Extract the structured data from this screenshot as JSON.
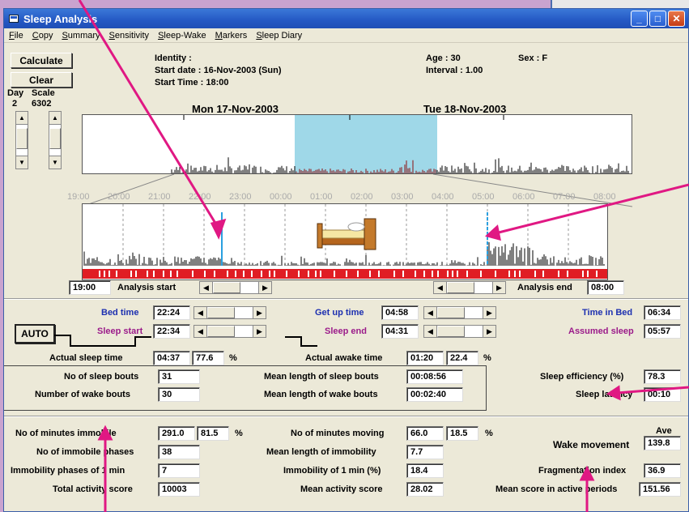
{
  "window": {
    "title": "Sleep Analysis"
  },
  "menu": [
    "File",
    "Copy",
    "Summary",
    "Sensitivity",
    "Sleep-Wake",
    "Markers",
    "Sleep Diary"
  ],
  "buttons": {
    "calculate": "Calculate",
    "clear": "Clear",
    "auto": "AUTO"
  },
  "controls": {
    "day_label": "Day",
    "day_value": "2",
    "scale_label": "Scale",
    "scale_value": "6302"
  },
  "header": {
    "identity": "Identity :",
    "start_date": "Start date : 16-Nov-2003 (Sun)",
    "start_time": "Start Time : 18:00",
    "age": "Age : 30",
    "sex": "Sex : F",
    "interval": "Interval  : 1.00"
  },
  "overview": {
    "date1": "Mon 17-Nov-2003",
    "date2": "Tue 18-Nov-2003"
  },
  "time_ticks": [
    "19:00",
    "20:00",
    "21:00",
    "22:00",
    "23:00",
    "00:00",
    "01:00",
    "02:00",
    "03:00",
    "04:00",
    "05:00",
    "06:00",
    "07:00",
    "08:00"
  ],
  "analysis": {
    "start_value": "19:00",
    "start_label": "Analysis start",
    "end_label": "Analysis end",
    "end_value": "08:00"
  },
  "times": {
    "bed_time_label": "Bed time",
    "bed_time": "22:24",
    "sleep_start_label": "Sleep start",
    "sleep_start": "22:34",
    "get_up_label": "Get up time",
    "get_up": "04:58",
    "sleep_end_label": "Sleep end",
    "sleep_end": "04:31",
    "time_in_bed_label": "Time in Bed",
    "time_in_bed": "06:34",
    "assumed_sleep_label": "Assumed sleep",
    "assumed_sleep": "05:57"
  },
  "actual": {
    "sleep_label": "Actual sleep time",
    "sleep_time": "04:37",
    "sleep_pct": "77.6",
    "pct": "%",
    "awake_label": "Actual awake time",
    "awake_time": "01:20",
    "awake_pct": "22.4"
  },
  "bouts": {
    "sleep_bouts_label": "No of sleep bouts",
    "sleep_bouts": "31",
    "wake_bouts_label": "Number of wake bouts",
    "wake_bouts": "30",
    "mean_sleep_label": "Mean length of sleep bouts",
    "mean_sleep": "00:08:56",
    "mean_wake_label": "Mean length of wake bouts",
    "mean_wake": "00:02:40",
    "efficiency_label": "Sleep efficiency (%)",
    "efficiency": "78.3",
    "latency_label": "Sleep latency",
    "latency": "00:10"
  },
  "activity": {
    "immobile_min_label": "No of minutes immobile",
    "immobile_min": "291.0",
    "immobile_pct": "81.5",
    "immobile_phases_label": "No of immobile phases",
    "immobile_phases": "38",
    "phases1_label": "Immobility phases of 1 min",
    "phases1": "7",
    "total_score_label": "Total activity score",
    "total_score": "10003",
    "moving_label": "No of minutes moving",
    "moving": "66.0",
    "moving_pct": "18.5",
    "mean_immob_label": "Mean length of immobility",
    "mean_immob": "7.7",
    "immob1_label": "Immobility of 1 min (%)",
    "immob1": "18.4",
    "mean_score_label": "Mean activity score",
    "mean_score": "28.02",
    "ave_label": "Ave",
    "wake_movement_label": "Wake movement",
    "wake_movement": "139.8",
    "frag_label": "Fragmentation index",
    "frag": "36.9",
    "active_label": "Mean score in active periods",
    "active": "151.56"
  },
  "colors": {
    "highlight": "#9fd8e8",
    "sleep_bar": "#e01d24",
    "activity": "#000000",
    "annotation": "#e01883"
  }
}
